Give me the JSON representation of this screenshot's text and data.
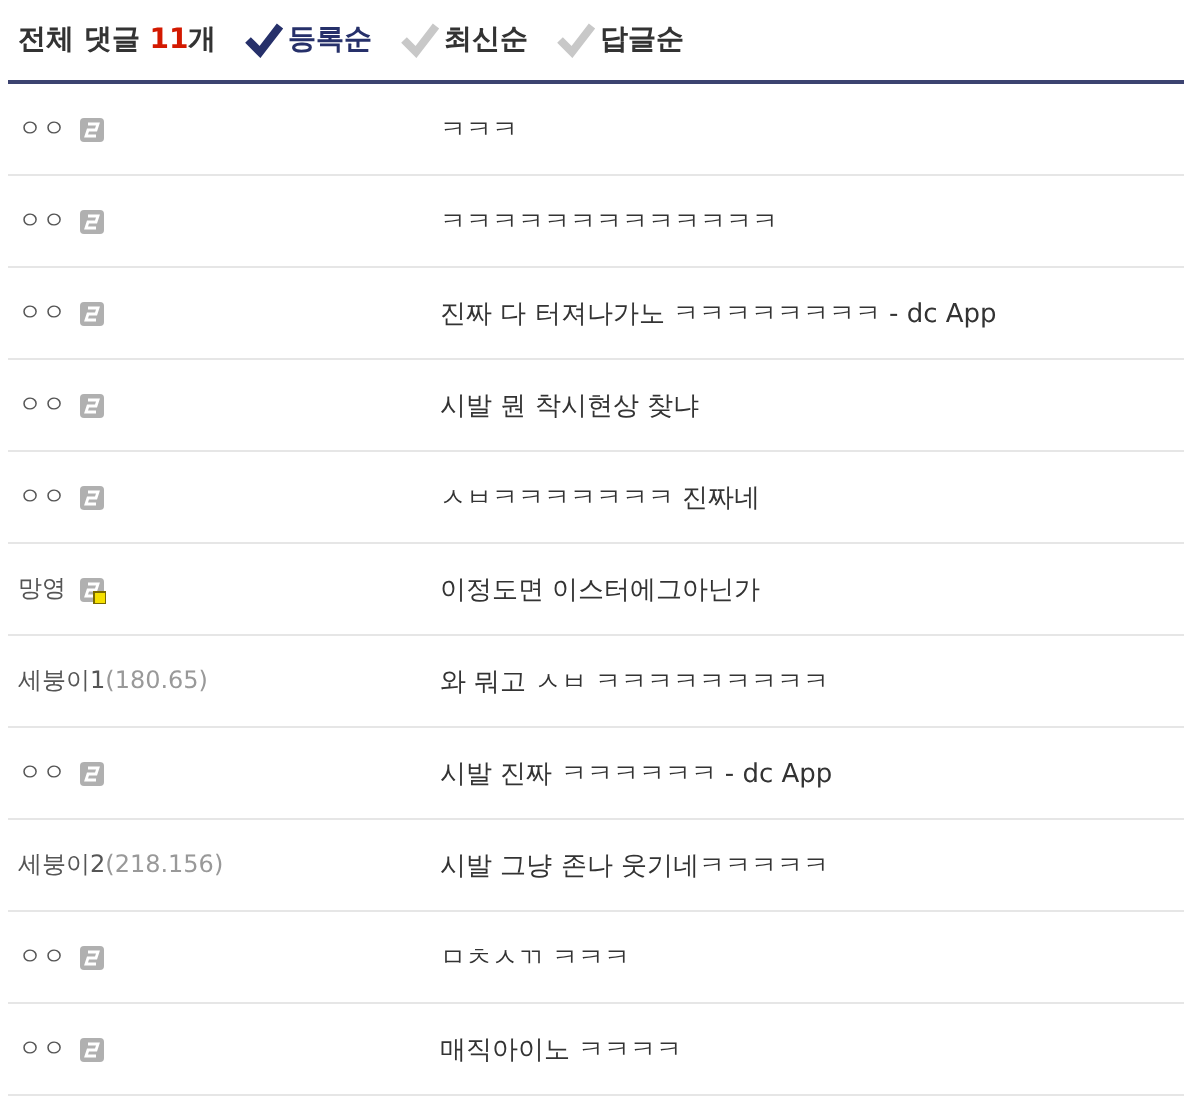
{
  "header": {
    "label": "전체 댓글",
    "count": "11",
    "unit": "개",
    "sorts": [
      {
        "label": "등록순",
        "selected": true
      },
      {
        "label": "최신순",
        "selected": false
      },
      {
        "label": "답글순",
        "selected": false
      }
    ]
  },
  "comments": [
    {
      "name": "ㅇㅇ",
      "kind": "gallery",
      "text": "ㅋㅋㅋ"
    },
    {
      "name": "ㅇㅇ",
      "kind": "gallery",
      "text": "ㅋㅋㅋㅋㅋㅋㅋㅋㅋㅋㅋㅋㅋ"
    },
    {
      "name": "ㅇㅇ",
      "kind": "gallery",
      "text": "진짜 다 터져나가노 ㅋㅋㅋㅋㅋㅋㅋㅋ - dc App"
    },
    {
      "name": "ㅇㅇ",
      "kind": "gallery",
      "text": "시발 뭔 착시현상 찾냐"
    },
    {
      "name": "ㅇㅇ",
      "kind": "gallery",
      "text": "ㅅㅂㅋㅋㅋㅋㅋㅋㅋ 진짜네"
    },
    {
      "name": "망영",
      "kind": "semi",
      "text": "이정도면 이스터에그아닌가"
    },
    {
      "name": "세붕이1",
      "ip": "(180.65)",
      "kind": "guest",
      "text": "와 뭐고 ㅅㅂ ㅋㅋㅋㅋㅋㅋㅋㅋㅋ"
    },
    {
      "name": "ㅇㅇ",
      "kind": "gallery",
      "text": "시발 진짜 ㅋㅋㅋㅋㅋㅋ - dc App"
    },
    {
      "name": "세붕이2",
      "ip": "(218.156)",
      "kind": "guest",
      "text": "시발 그냥 존나 웃기네ㅋㅋㅋㅋㅋ"
    },
    {
      "name": "ㅇㅇ",
      "kind": "gallery",
      "text": "ㅁㅊㅅㄲ ㅋㅋㅋ"
    },
    {
      "name": "ㅇㅇ",
      "kind": "gallery",
      "text": "매직아이노 ㅋㅋㅋㅋ"
    }
  ]
}
